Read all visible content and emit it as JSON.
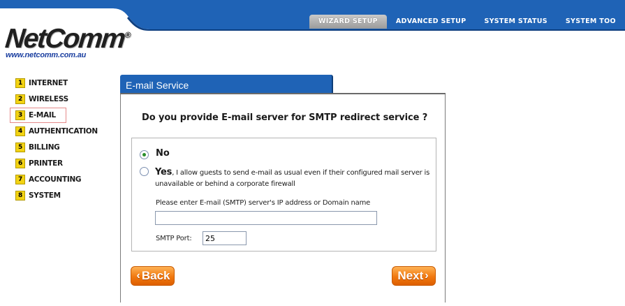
{
  "header": {
    "tabs": [
      {
        "label": "WIZARD SETUP",
        "active": true
      },
      {
        "label": "ADVANCED SETUP",
        "active": false
      },
      {
        "label": "SYSTEM STATUS",
        "active": false
      },
      {
        "label": "SYSTEM TOO",
        "active": false
      }
    ],
    "brand_color": "#1f63b6"
  },
  "logo": {
    "name": "NetComm",
    "registered": "®",
    "url": "www.netcomm.com.au"
  },
  "nav": {
    "items": [
      {
        "num": "1",
        "label": "INTERNET"
      },
      {
        "num": "2",
        "label": "WIRELESS"
      },
      {
        "num": "3",
        "label": "E-MAIL"
      },
      {
        "num": "4",
        "label": "AUTHENTICATION"
      },
      {
        "num": "5",
        "label": "BILLING"
      },
      {
        "num": "6",
        "label": "PRINTER"
      },
      {
        "num": "7",
        "label": "ACCOUNTING"
      },
      {
        "num": "8",
        "label": "SYSTEM"
      }
    ],
    "active_index": 2
  },
  "panel": {
    "title": "E-mail Service",
    "question": "Do you provide E-mail server for SMTP redirect service ?",
    "option_no": "No",
    "option_yes": "Yes",
    "yes_description": ", I allow guests to send e-mail as usual even if their configured mail server is unavailable or behind a corporate firewall",
    "selected": "No",
    "server_label": "Please enter E-mail (SMTP) server's IP address or Domain name",
    "server_value": "",
    "port_label": "SMTP Port:",
    "port_value": "25"
  },
  "buttons": {
    "back": "Back",
    "next": "Next"
  }
}
